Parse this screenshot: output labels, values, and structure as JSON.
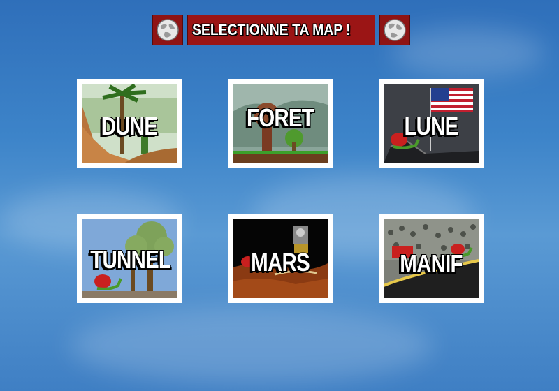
{
  "header": {
    "title": "SELECTIONNE TA MAP !",
    "left_icon": "globe-icon",
    "right_icon": "globe-icon"
  },
  "colors": {
    "header_red": "#9b1515",
    "card_border": "#ffffff",
    "sky_blue": "#3d84c9"
  },
  "maps": [
    {
      "label": "DUNE"
    },
    {
      "label": "FORET"
    },
    {
      "label": "LUNE"
    },
    {
      "label": "TUNNEL"
    },
    {
      "label": "MARS"
    },
    {
      "label": "MANIF"
    }
  ]
}
